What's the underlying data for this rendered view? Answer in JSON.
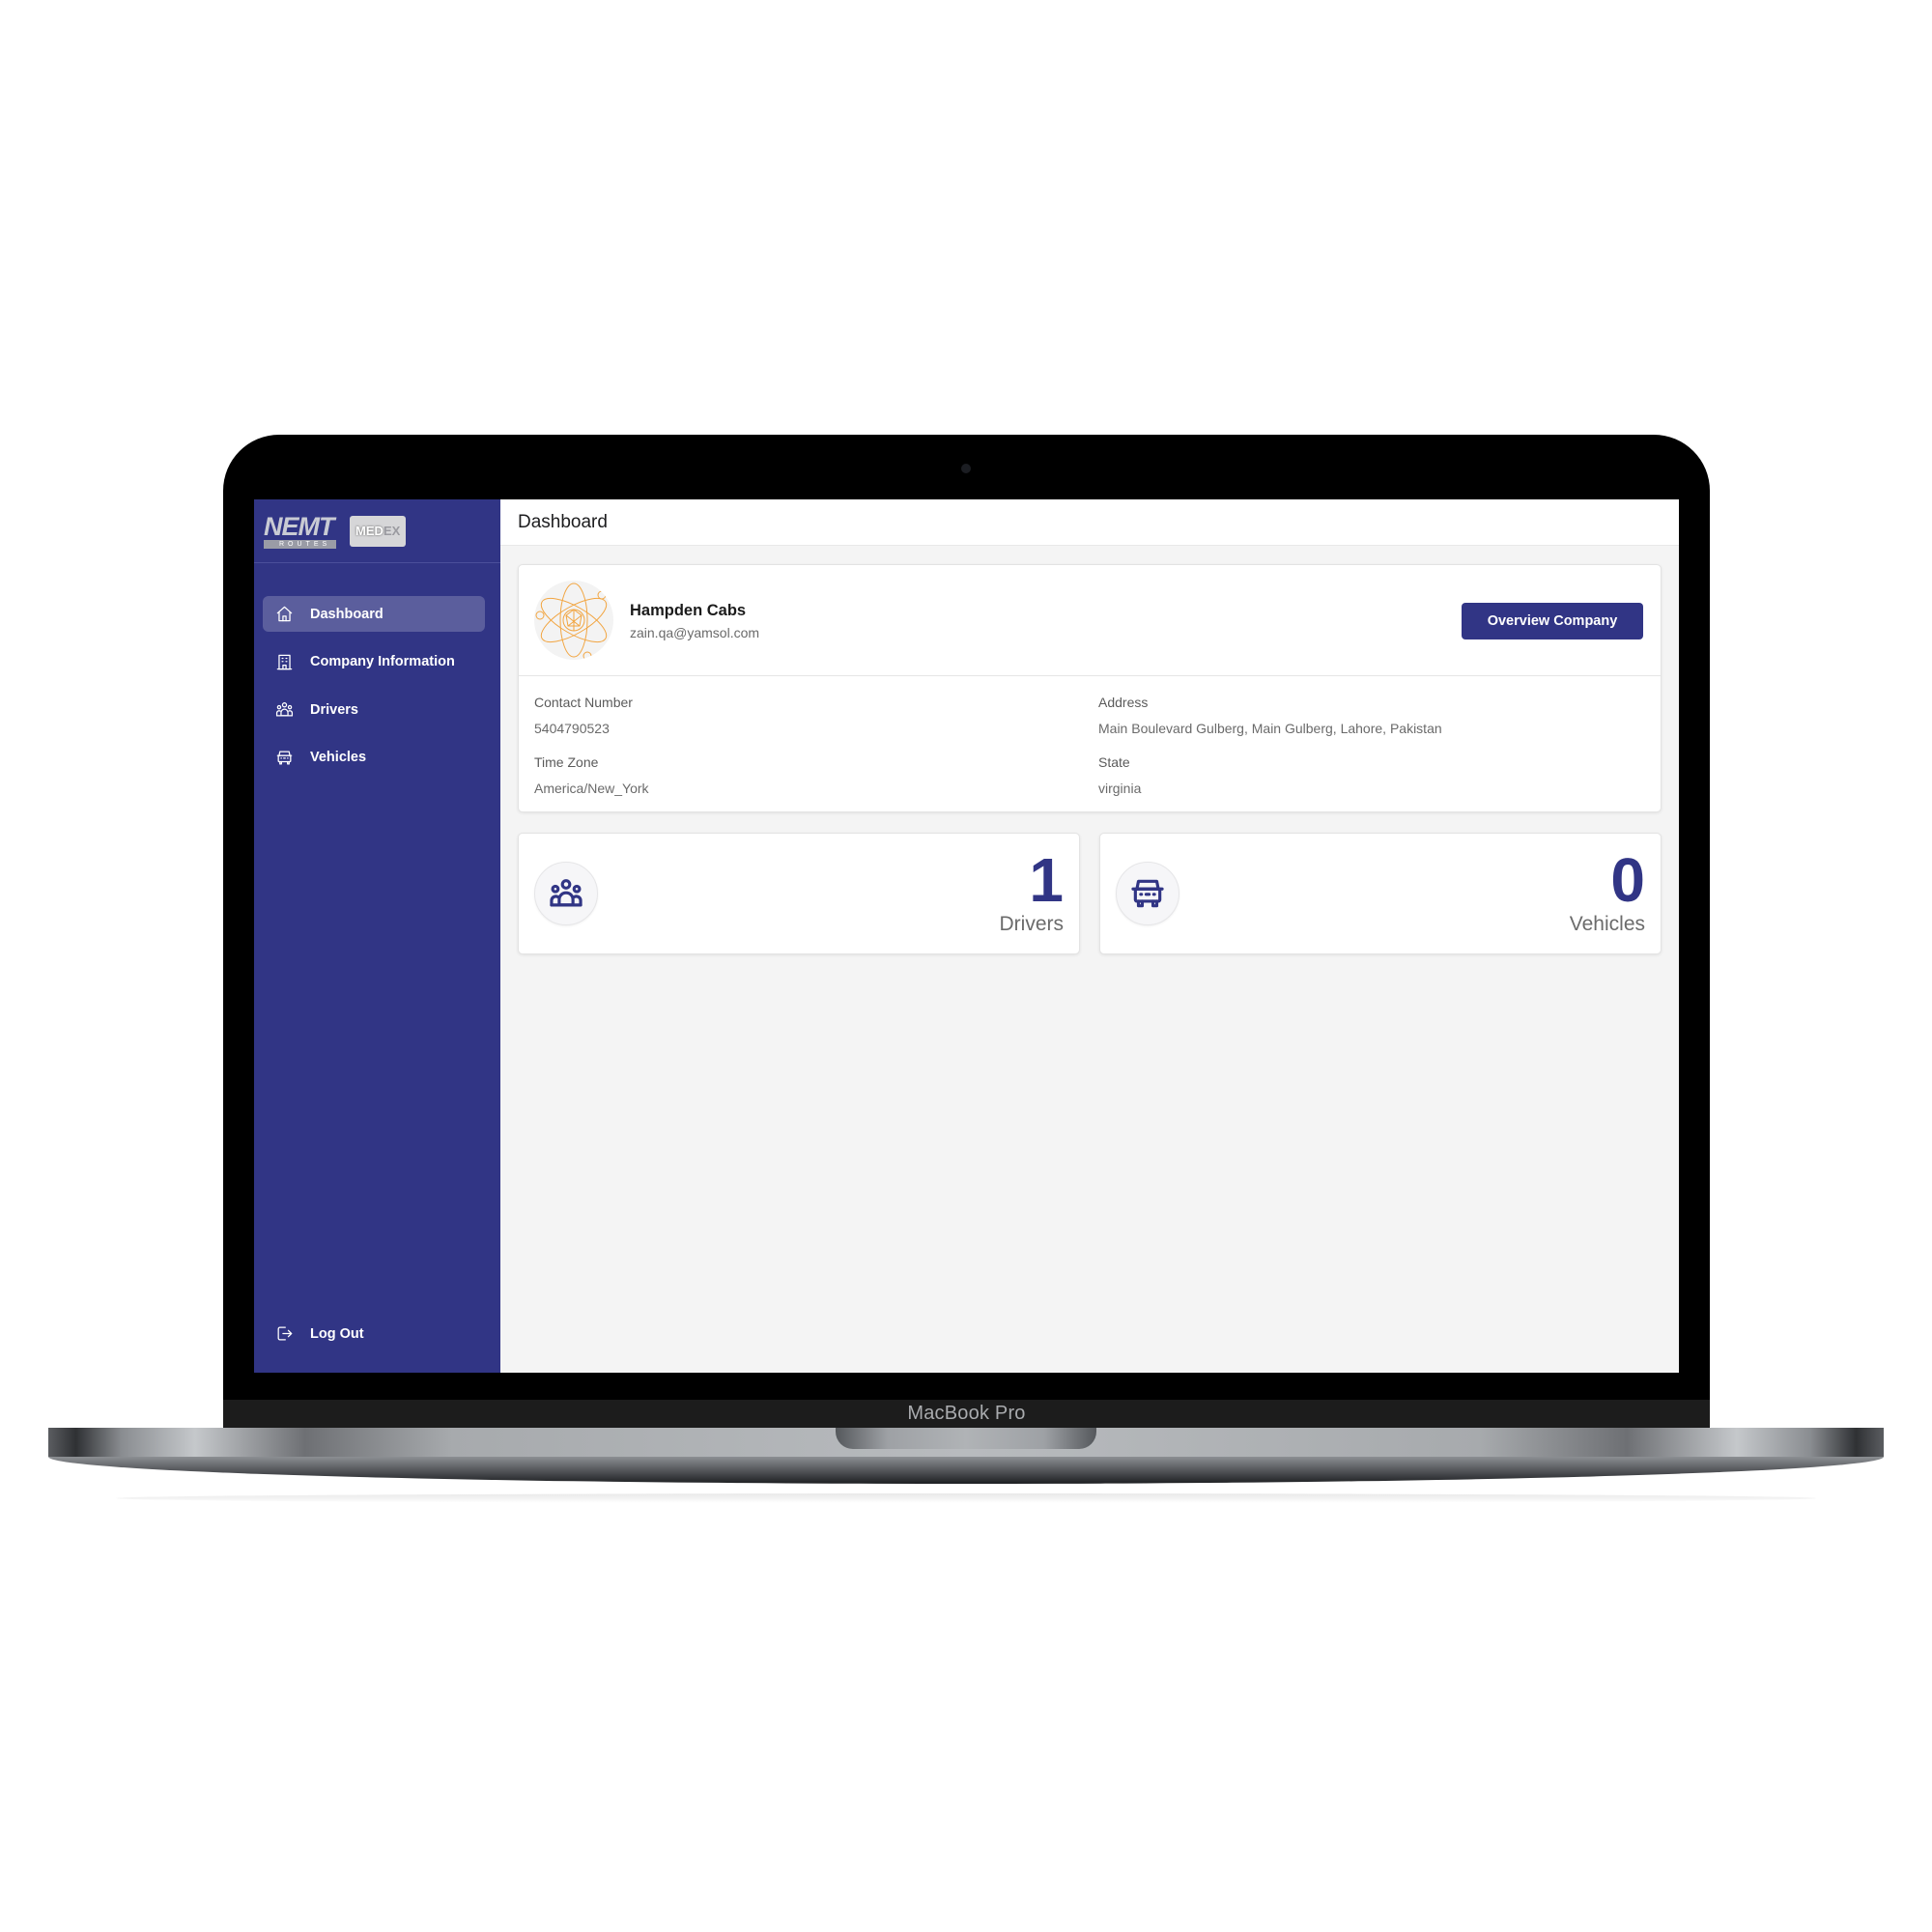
{
  "device": {
    "label": "MacBook Pro"
  },
  "sidebar": {
    "logo_primary": "NEMT",
    "logo_primary_sub": "ROUTES",
    "logo_secondary_a": "MED",
    "logo_secondary_b": "EX",
    "items": [
      {
        "label": "Dashboard",
        "icon": "home-icon",
        "active": true
      },
      {
        "label": "Company Information",
        "icon": "building-icon",
        "active": false
      },
      {
        "label": "Drivers",
        "icon": "users-icon",
        "active": false
      },
      {
        "label": "Vehicles",
        "icon": "vehicle-icon",
        "active": false
      }
    ],
    "logout_label": "Log Out",
    "logout_icon": "logout-icon"
  },
  "header": {
    "title": "Dashboard"
  },
  "company": {
    "name": "Hampden Cabs",
    "email": "zain.qa@yamsol.com",
    "overview_button": "Overview Company",
    "fields": {
      "contact_label": "Contact Number",
      "contact_value": "5404790523",
      "address_label": "Address",
      "address_value": "Main Boulevard Gulberg, Main Gulberg, Lahore, Pakistan",
      "timezone_label": "Time Zone",
      "timezone_value": "America/New_York",
      "state_label": "State",
      "state_value": "virginia"
    }
  },
  "stats": [
    {
      "value": "1",
      "label": "Drivers",
      "icon": "users-icon"
    },
    {
      "value": "0",
      "label": "Vehicles",
      "icon": "vehicle-icon"
    }
  ],
  "colors": {
    "brand": "#313585",
    "sidebar_active": "#5b5e9d",
    "background": "#f4f4f4",
    "avatar_accent": "#f2a541"
  }
}
